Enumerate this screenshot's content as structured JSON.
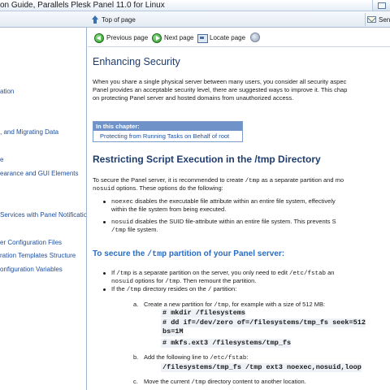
{
  "window": {
    "title": "on Guide, Parallels Plesk Panel 11.0 for Linux"
  },
  "toolbar": {
    "top_of_page": "Top of page",
    "send": "Send"
  },
  "toc": {
    "items": [
      "ation",
      ", and Migrating Data",
      "e",
      "earance and GUI Elements",
      "Services with Panel Notificatio",
      "er Configuration Files",
      "ration Templates Structure",
      "onfiguration Variables"
    ]
  },
  "nav": {
    "previous": "Previous page",
    "next": "Next page",
    "locate": "Locate page"
  },
  "article": {
    "title": "Enhancing Security",
    "intro": [
      "When you share a single physical server between many users, you consider all security aspec",
      "Panel provides an acceptable security level, there are suggested ways to improve it. This chap",
      "on protecting Panel server and hosted domains from unauthorized access."
    ],
    "chapter_box": {
      "heading": "In this chapter:",
      "link": "Protecting from Running Tasks on Behalf of root"
    },
    "section_title": "Restricting Script Execution in the /tmp Directory",
    "section_para": {
      "l1a": "To secure the Panel server, it is recommended to create ",
      "l1code": "/tmp",
      "l1b": " as a separate partition and mo",
      "l2code": "nosuid",
      "l2b": " options. These options do the following:"
    },
    "options": [
      {
        "code": "noexec",
        "line1": " disables the executable file attribute within an entire file system, effectively",
        "line2": "within the file system from being executed."
      },
      {
        "code": "nosuid",
        "line1": " disables the SUID file-attribute within an entire file system. This prevents S",
        "line2code": "/tmp",
        "line2": " file system."
      }
    ],
    "subsection": {
      "pre": "To secure the ",
      "code": "/tmp",
      "post": " partition of your Panel server:"
    },
    "steps": {
      "b1": {
        "a": "If ",
        "code1": "/tmp",
        "b": " is a separate partition on the server, you only need to edit ",
        "code2": "/etc/fstab",
        "c": " an"
      },
      "b1l2": {
        "code": "nosuid",
        "a": " options for ",
        "code2": "/tmp",
        "b": ". Then remount the partition."
      },
      "b2": {
        "a": "If the ",
        "code": "/tmp",
        "b": " directory resides on the ",
        "code2": "/",
        "c": " partition:"
      },
      "a": {
        "letter": "a.",
        "text_a": "Create a new partition for ",
        "code": "/tmp",
        "text_b": ", for example with a size of 512 MB:"
      },
      "code_a": [
        "# mkdir /filesystems",
        "# dd if=/dev/zero of=/filesystems/tmp_fs seek=512",
        "bs=1M",
        "# mkfs.ext3 /filesystems/tmp_fs"
      ],
      "b": {
        "letter": "b.",
        "text_a": "Add the following line to ",
        "code": "/etc/fstab",
        "text_b": ":"
      },
      "code_b": "/filesystems/tmp_fs /tmp ext3 noexec,nosuid,loop",
      "c": {
        "letter": "c.",
        "text_a": "Move the current ",
        "code": "/tmp",
        "text_b": " directory content to another location."
      }
    }
  }
}
